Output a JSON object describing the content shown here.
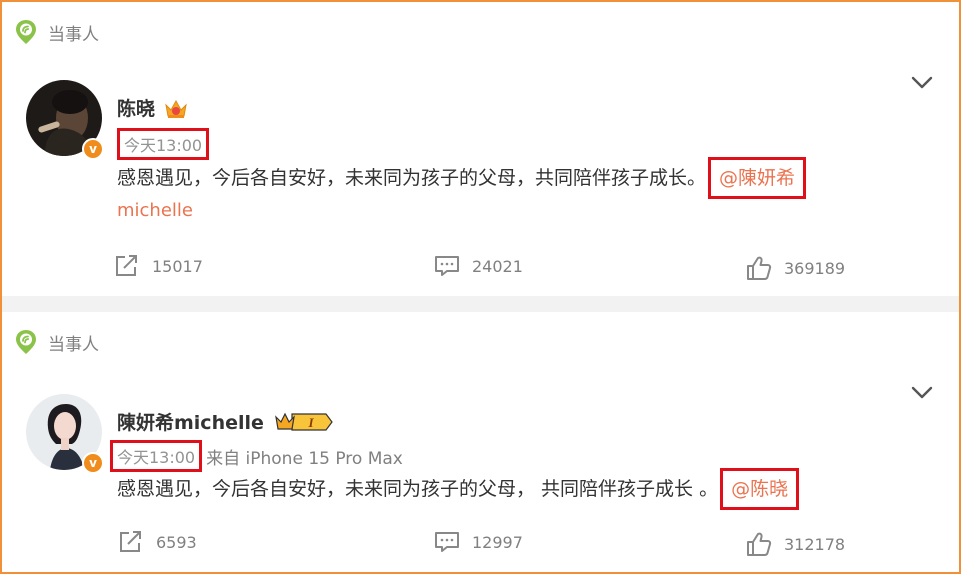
{
  "posts": [
    {
      "tag_label": "当事人",
      "author_name": "陈晓",
      "vip_badge_label": "",
      "verified_mark": "v",
      "timestamp": "今天13:00",
      "source": "",
      "content_text": "感恩遇见，今后各自安好，未来同为孩子的父母，共同陪伴孩子成长。",
      "mention": "@陳妍希",
      "mention_continued": "michelle",
      "shares": "15017",
      "comments": "24021",
      "likes": "369189"
    },
    {
      "tag_label": "当事人",
      "author_name": "陳妍希michelle",
      "vip_badge_label": "I",
      "verified_mark": "v",
      "timestamp": "今天13:00",
      "source": "来自 iPhone 15 Pro Max",
      "content_text": "感恩遇见，今后各自安好，未来同为孩子的父母， 共同陪伴孩子成长 。",
      "mention": "@陈晓",
      "mention_continued": "",
      "shares": "6593",
      "comments": "12997",
      "likes": "312178"
    }
  ],
  "colors": {
    "frame_border": "#f0913a",
    "highlight_box": "#e0101a",
    "mention": "#eb7350",
    "tag_icon": "#8bc34a",
    "muted_text": "#808080",
    "verified_badge": "#f08c1c"
  },
  "icons": {
    "tag": "location-pin-icon",
    "menu": "chevron-down-icon",
    "share": "share-icon",
    "comment": "comment-icon",
    "like": "thumbs-up-icon",
    "crown": "crown-icon",
    "vip": "vip-badge-icon"
  }
}
